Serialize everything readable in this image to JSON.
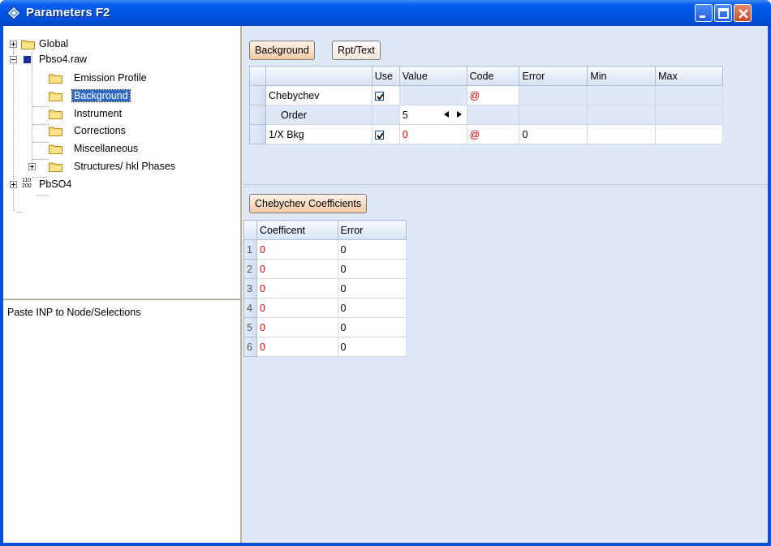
{
  "window": {
    "title": "Parameters F2"
  },
  "tree": {
    "items": [
      {
        "label": "Global"
      },
      {
        "label": "Pbso4.raw"
      },
      {
        "label": "Emission Profile"
      },
      {
        "label": "Background"
      },
      {
        "label": "Instrument"
      },
      {
        "label": "Corrections"
      },
      {
        "label": "Miscellaneous"
      },
      {
        "label": "Structures/ hkl Phases"
      },
      {
        "label": "PbSO4"
      }
    ],
    "hkl_icon_top": "110",
    "hkl_icon_bottom": "200"
  },
  "paste_area": {
    "text": "Paste INP to Node/Selections"
  },
  "tabs": {
    "background": "Background",
    "rpt_text": "Rpt/Text"
  },
  "bg_table": {
    "headers": [
      "Use",
      "Value",
      "Code",
      "Error",
      "Min",
      "Max"
    ],
    "rows": [
      {
        "name": "Chebychev",
        "use": true,
        "value": "",
        "code": "@",
        "error": "",
        "min": "",
        "max": ""
      },
      {
        "name": "Order",
        "use": false,
        "value": "5",
        "code": "",
        "error": "",
        "min": "",
        "max": ""
      },
      {
        "name": "1/X Bkg",
        "use": true,
        "value": "0",
        "code": "@",
        "error": "0",
        "min": "",
        "max": ""
      }
    ]
  },
  "coef_button": "Chebychev Coefficients",
  "coef_table": {
    "headers": [
      "Coefficent",
      "Error"
    ],
    "rows": [
      {
        "idx": "1",
        "coef": "0",
        "error": "0"
      },
      {
        "idx": "2",
        "coef": "0",
        "error": "0"
      },
      {
        "idx": "3",
        "coef": "0",
        "error": "0"
      },
      {
        "idx": "4",
        "coef": "0",
        "error": "0"
      },
      {
        "idx": "5",
        "coef": "0",
        "error": "0"
      },
      {
        "idx": "6",
        "coef": "0",
        "error": "0"
      }
    ]
  },
  "colors": {
    "title_bar": "#0054e3",
    "selected": "#316ac5",
    "accent_red": "#e00000",
    "pane_blue": "#dfe8f6"
  }
}
